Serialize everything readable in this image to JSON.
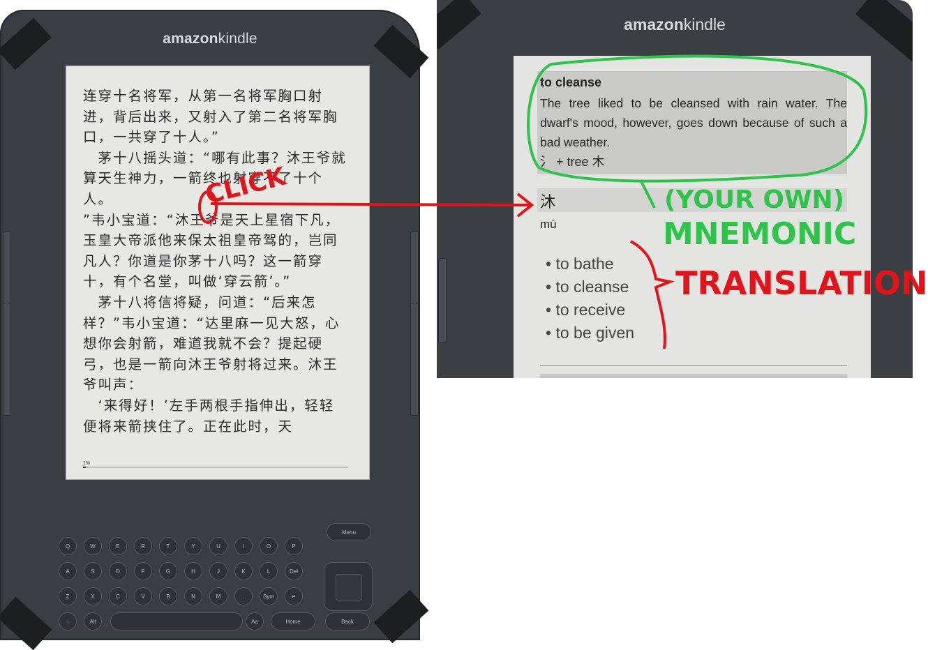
{
  "left_device": {
    "brand_amazon": "amazon",
    "brand_kindle": "kindle",
    "paragraphs": [
      "连穿十名将军，从第一名将军胸口射进，背后出来，又射入了第二名将军胸口，一共穿了十人。”",
      "　茅十八摇头道：“哪有此事？沐王爷就算天生神力，一箭终也射穿不了十个人。",
      "”韦小宝道：“沐王爷是天上星宿下凡，玉皇大帝派他来保太祖皇帝驾的，岂同凡人？你道是你茅十八吗？这一箭穿十，有个名堂，叫做‘穿云箭’。”",
      "　茅十八将信将疑，问道：“后来怎样？”韦小宝道：“达里麻一见大怒，心想你会射箭，难道我就不会？提起硬弓，也是一箭向沐王爷射将过来。沐王爷叫声：",
      "　‘来得好！’左手两根手指伸出，轻轻便将来箭挟住了。正在此时，天"
    ],
    "progress_label": "1%",
    "progress_value": 0.01,
    "keyboard": {
      "row1": [
        "Q",
        "W",
        "E",
        "R",
        "T",
        "Y",
        "U",
        "I",
        "O",
        "P"
      ],
      "row2": [
        "A",
        "S",
        "D",
        "F",
        "G",
        "H",
        "J",
        "K",
        "L",
        "Del"
      ],
      "row3": [
        "Z",
        "X",
        "C",
        "V",
        "B",
        "N",
        "M",
        ".",
        "Sym",
        "↵"
      ],
      "row4_shift": "↑",
      "row4_alt": "Alt",
      "row4_aa": "Aa",
      "menu": "Menu",
      "home": "Home",
      "back": "Back"
    }
  },
  "right_device": {
    "brand_amazon": "amazon",
    "brand_kindle": "kindle",
    "mnemonic": {
      "title": "to cleanse",
      "story": "The tree liked to be cleansed with rain water. The dwarf's mood, however, goes down because of such a bad weather.",
      "decomposition": "氵 + tree 木"
    },
    "character": "沐",
    "pinyin": "mù",
    "translations": [
      "to bathe",
      "to cleanse",
      "to receive",
      "to be given"
    ]
  },
  "annotations": {
    "click": "CLICK",
    "your_own": "(YOUR OWN)",
    "mnemonic": "MNEMONIC",
    "translation": "TRANSLATION",
    "colors": {
      "red": "#e0141b",
      "green": "#2ec44a"
    }
  }
}
